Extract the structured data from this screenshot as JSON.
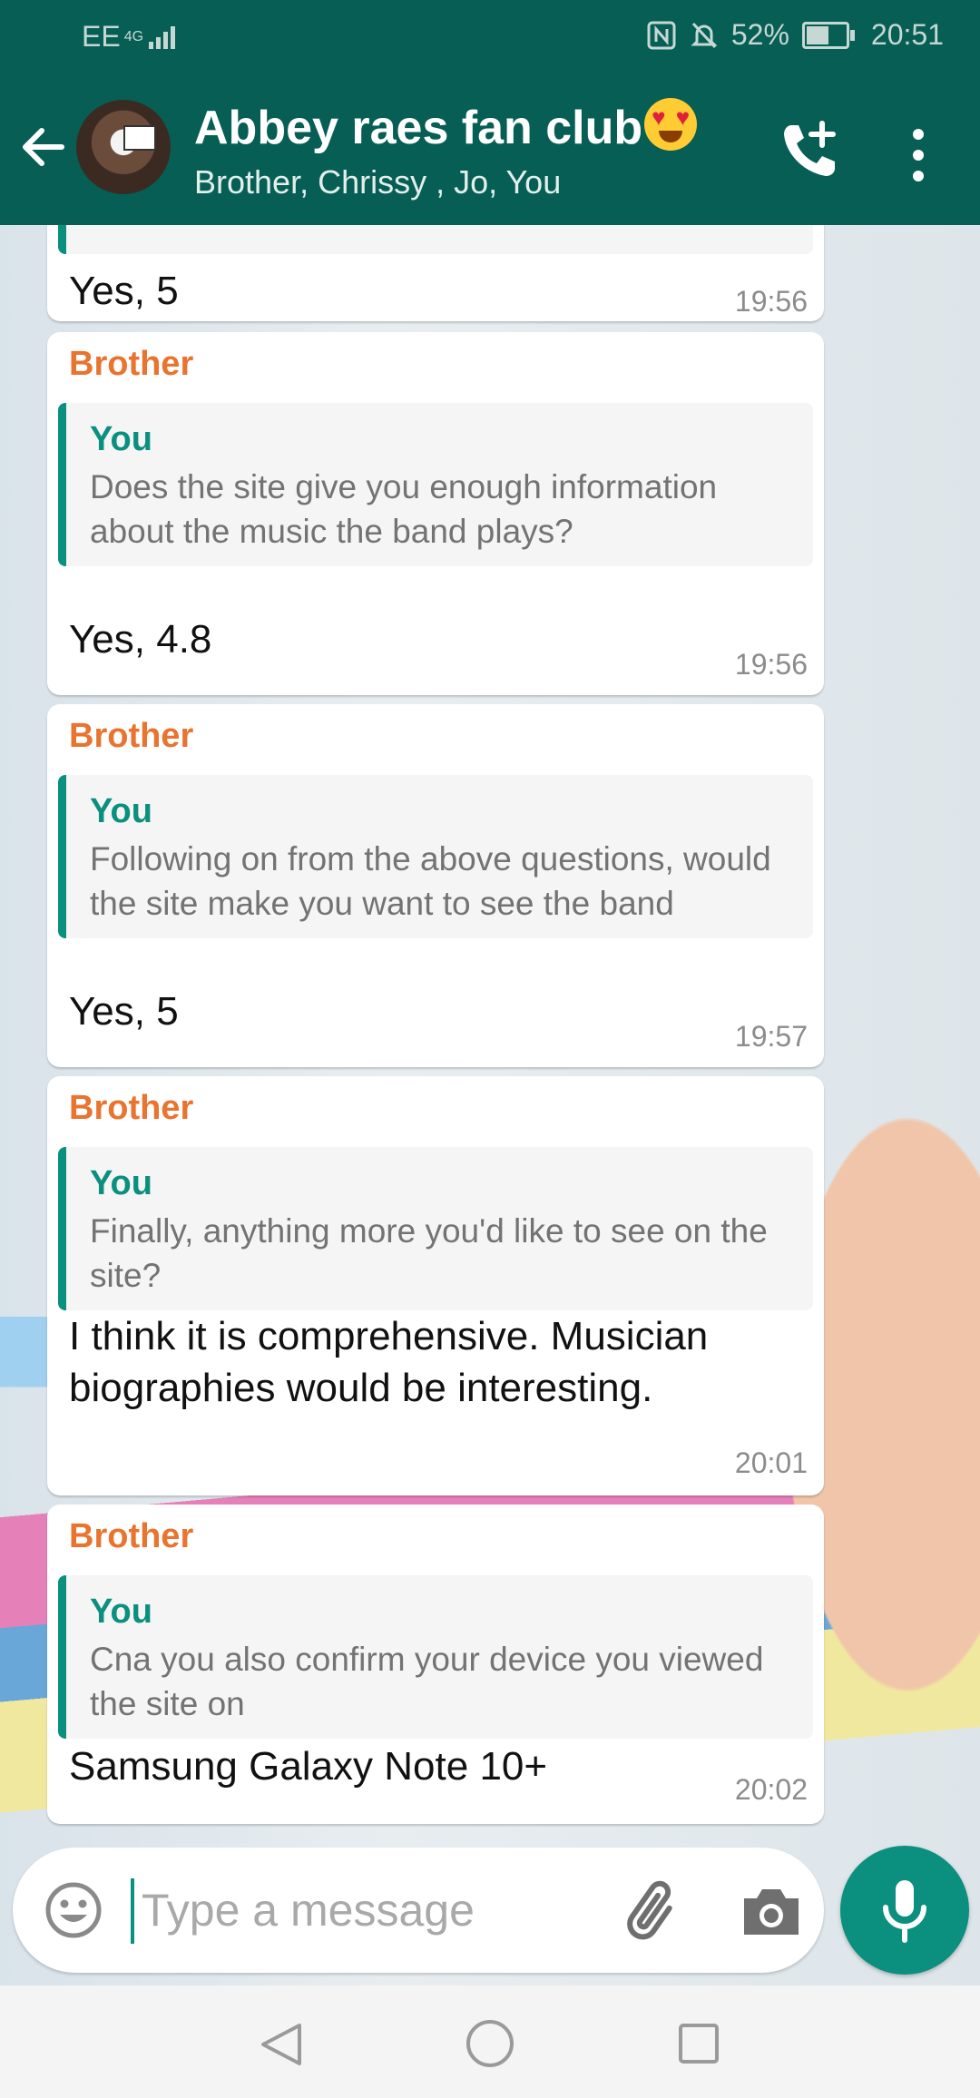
{
  "status_bar": {
    "carrier": "EE",
    "network": "4G",
    "battery": "52%",
    "time": "20:51",
    "battery_level": 0.52
  },
  "header": {
    "title": "Abbey raes fan club",
    "subtitle": "Brother, Chrissy , Jo, You"
  },
  "messages": [
    {
      "text": "Yes, 5",
      "time": "19:56"
    },
    {
      "sender": "Brother",
      "quote_author": "You",
      "quote_text": "Does the site give you enough information about the music the band plays?",
      "text": "Yes, 4.8",
      "time": "19:56"
    },
    {
      "sender": "Brother",
      "quote_author": "You",
      "quote_text": "Following on from the above questions, would the site make you want to see the band",
      "text": "Yes, 5",
      "time": "19:57"
    },
    {
      "sender": "Brother",
      "quote_author": "You",
      "quote_text": "Finally, anything more you'd like to see on the site?",
      "text": "I think it is comprehensive. Musician biographies would be interesting.",
      "time": "20:01"
    },
    {
      "sender": "Brother",
      "quote_author": "You",
      "quote_text": "Cna you also confirm your device you viewed the site on",
      "text": "Samsung Galaxy Note 10+",
      "time": "20:02"
    }
  ],
  "composer": {
    "placeholder": "Type a message"
  },
  "colors": {
    "brand": "#075e54",
    "accent": "#0b8f7f",
    "sender": "#e8742f"
  }
}
